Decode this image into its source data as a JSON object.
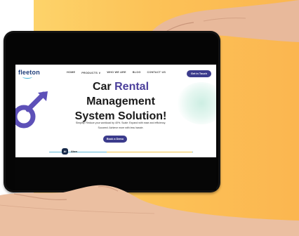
{
  "site": {
    "logo": "fleeton",
    "nav": [
      "HOME",
      "PRODUCTS ∨",
      "WHO WE ARE",
      "BLOG",
      "CONTACT US"
    ],
    "cta": "Get in Touch",
    "headline_line1_prefix": "Car",
    "headline_line1_accent": "Rental",
    "headline_line2": "Management",
    "headline_line3": "System Solution!",
    "sub1": "Simplify: Reduce your workload by 40%. Scale: Expand with ease and efficiency.",
    "sub2": "Succeed: Achieve more with less hassle.",
    "demo_button": "Book a Demo",
    "aion_badge": "AI",
    "aion_label": "Aion"
  },
  "colors": {
    "orange": "#fbb650",
    "brand": "#3b3b8c",
    "accent_text": "#4b3f9b",
    "mint": "#cdeee3"
  }
}
